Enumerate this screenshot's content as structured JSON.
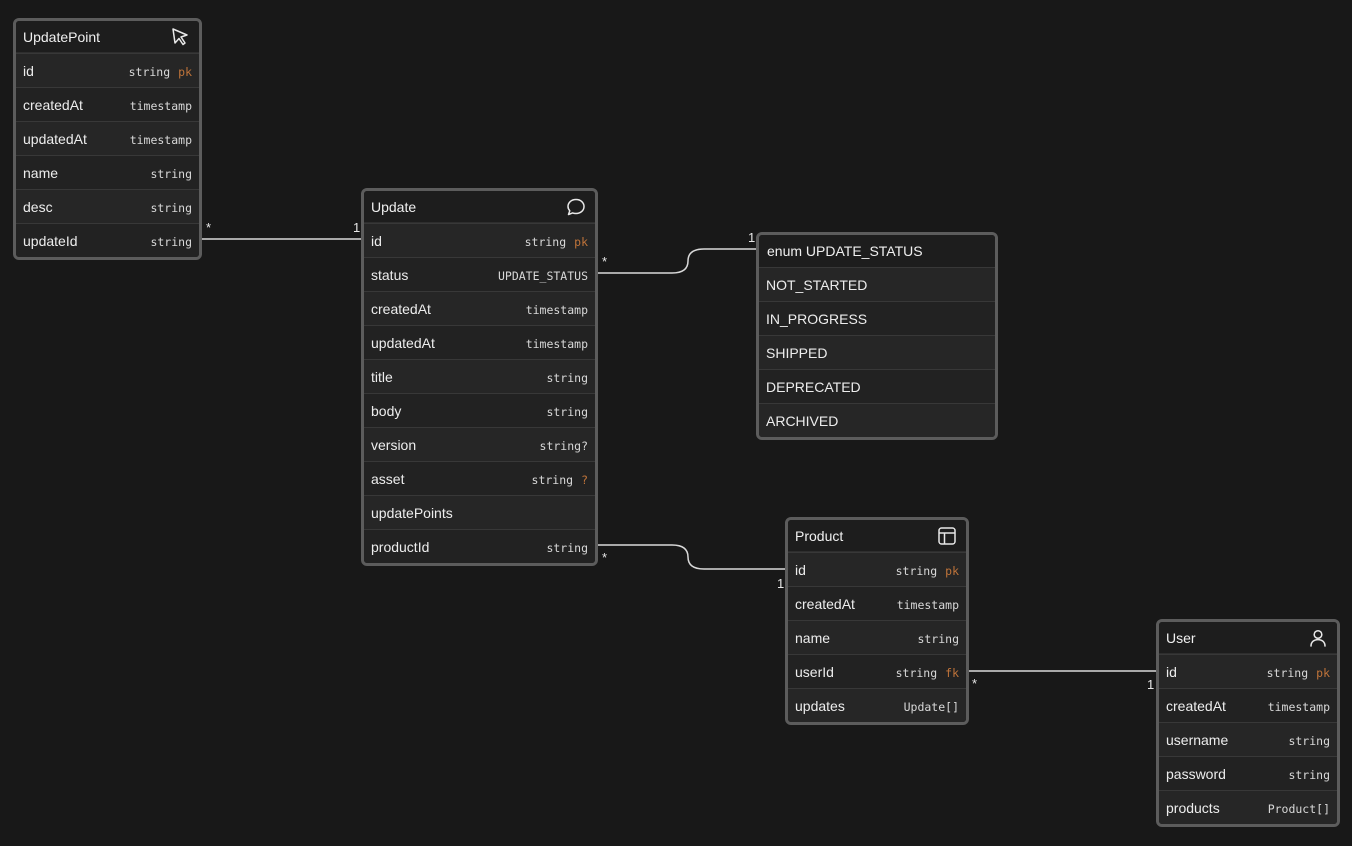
{
  "tables": {
    "updatepoint": {
      "title": "UpdatePoint",
      "icon": "cursor-arrow-icon",
      "fields": [
        {
          "name": "id",
          "type": "string",
          "mod": "pk"
        },
        {
          "name": "createdAt",
          "type": "timestamp",
          "mod": ""
        },
        {
          "name": "updatedAt",
          "type": "timestamp",
          "mod": ""
        },
        {
          "name": "name",
          "type": "string",
          "mod": ""
        },
        {
          "name": "desc",
          "type": "string",
          "mod": ""
        },
        {
          "name": "updateId",
          "type": "string",
          "mod": ""
        }
      ]
    },
    "update": {
      "title": "Update",
      "icon": "chat-bubble-icon",
      "fields": [
        {
          "name": "id",
          "type": "string",
          "mod": "pk"
        },
        {
          "name": "status",
          "type": "UPDATE_STATUS",
          "mod": ""
        },
        {
          "name": "createdAt",
          "type": "timestamp",
          "mod": ""
        },
        {
          "name": "updatedAt",
          "type": "timestamp",
          "mod": ""
        },
        {
          "name": "title",
          "type": "string",
          "mod": ""
        },
        {
          "name": "body",
          "type": "string",
          "mod": ""
        },
        {
          "name": "version",
          "type": "string?",
          "mod": ""
        },
        {
          "name": "asset",
          "type": "string",
          "mod": "?"
        },
        {
          "name": "updatePoints",
          "type": "",
          "mod": ""
        },
        {
          "name": "productId",
          "type": "string",
          "mod": ""
        }
      ]
    },
    "product": {
      "title": "Product",
      "icon": "layout-panel-icon",
      "fields": [
        {
          "name": "id",
          "type": "string",
          "mod": "pk"
        },
        {
          "name": "createdAt",
          "type": "timestamp",
          "mod": ""
        },
        {
          "name": "name",
          "type": "string",
          "mod": ""
        },
        {
          "name": "userId",
          "type": "string",
          "mod": "fk"
        },
        {
          "name": "updates",
          "type": "Update[]",
          "mod": ""
        }
      ]
    },
    "user": {
      "title": "User",
      "icon": "user-icon",
      "fields": [
        {
          "name": "id",
          "type": "string",
          "mod": "pk"
        },
        {
          "name": "createdAt",
          "type": "timestamp",
          "mod": ""
        },
        {
          "name": "username",
          "type": "string",
          "mod": ""
        },
        {
          "name": "password",
          "type": "string",
          "mod": ""
        },
        {
          "name": "products",
          "type": "Product[]",
          "mod": ""
        }
      ]
    }
  },
  "enum": {
    "title": "enum UPDATE_STATUS",
    "values": [
      "NOT_STARTED",
      "IN_PROGRESS",
      "SHIPPED",
      "DEPRECATED",
      "ARCHIVED"
    ]
  },
  "relations": {
    "updatepoint_update": {
      "from": "*",
      "to": "1"
    },
    "update_status_enum": {
      "from": "*",
      "to": "1"
    },
    "update_product": {
      "from": "*",
      "to": "1"
    },
    "product_user": {
      "from": "*",
      "to": "1"
    }
  },
  "colors": {
    "background": "#181818",
    "border": "#5c5c5c",
    "modifier": "#c0743a",
    "edge": "#d9d9d9"
  }
}
